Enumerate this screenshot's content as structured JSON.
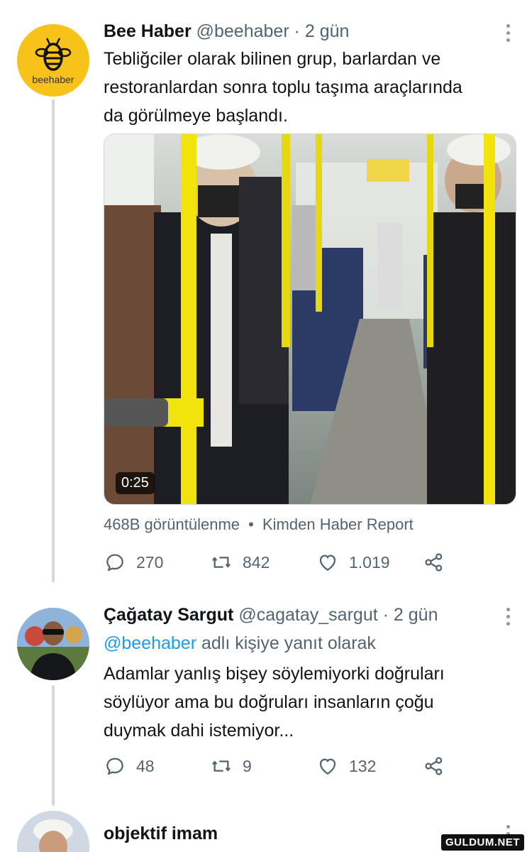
{
  "tweet1": {
    "avatar_text": "beehaber",
    "name": "Bee Haber",
    "handle": "@beehaber",
    "dot": "·",
    "time": "2 gün",
    "text_line1": "Tebliğciler olarak bilinen grup, barlardan ve",
    "text_line2": "restoranlardan sonra toplu taşıma araçlarında",
    "text_line3": "da görülmeye başlandı.",
    "video_duration": "0:25",
    "views": "468B görüntülenme",
    "meta_sep": "•",
    "source": "Kimden Haber Report",
    "replies": "270",
    "retweets": "842",
    "likes": "1.019"
  },
  "tweet2": {
    "name": "Çağatay Sargut",
    "handle": "@cagatay_sargut",
    "dot": "·",
    "time": "2 gün",
    "reply_mention": "@beehaber",
    "reply_suffix": "adlı kişiye yanıt olarak",
    "text_line1": "Adamlar yanlış bişey söylemiyorki doğruları",
    "text_line2": "söylüyor ama bu doğruları insanların çoğu",
    "text_line3": "duymak dahi istemiyor...",
    "replies": "48",
    "retweets": "9",
    "likes": "132"
  },
  "tweet3": {
    "name": "objektif imam"
  },
  "watermark": "GULDUM.NET",
  "colors": {
    "accent": "#1d9bf0",
    "muted": "#536471",
    "thread_line": "#cfd9de",
    "bee_yellow": "#f7c21a"
  }
}
